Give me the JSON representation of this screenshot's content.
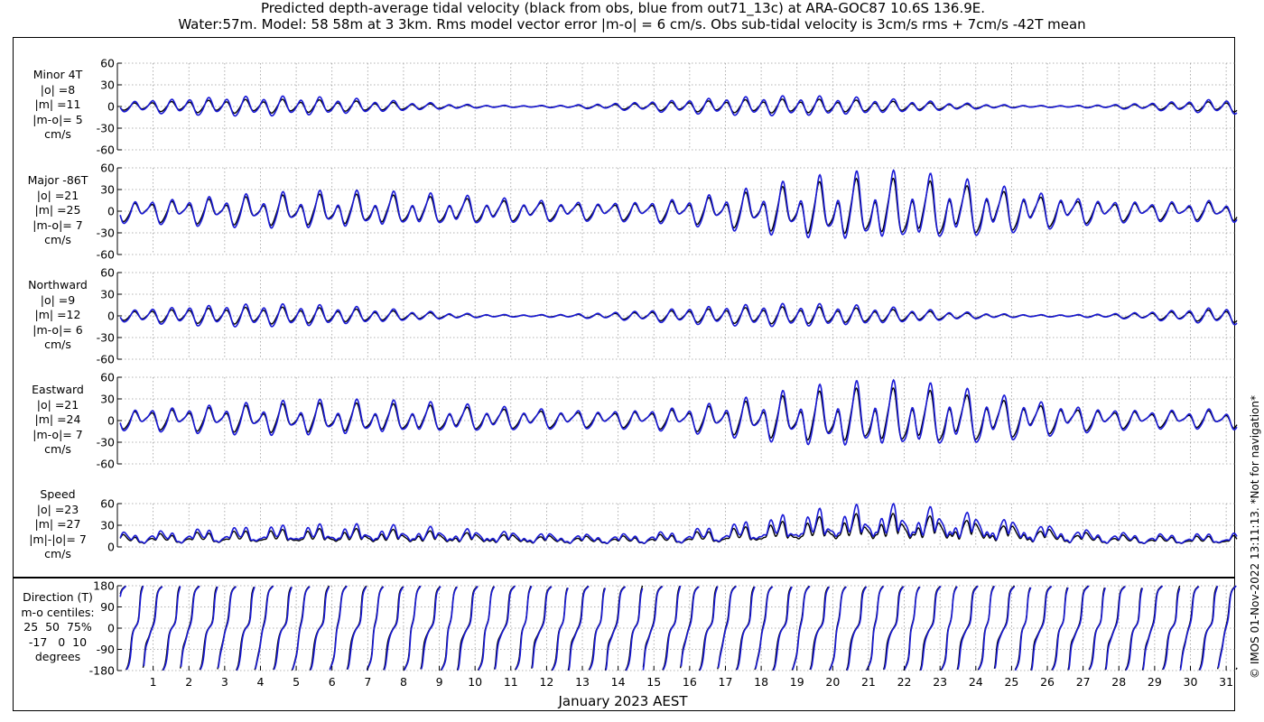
{
  "title_line1": "Predicted depth-average tidal velocity (black from obs, blue from out71_13c) at ARA-GOC87 10.6S 136.9E.",
  "title_line2": "Water:57m. Model: 58 58m at 3 3km. Rms model vector error |m-o| = 6 cm/s. Obs sub-tidal velocity is 3cm/s rms + 7cm/s -42T mean",
  "xlabel": "January 2023 AEST",
  "copyright": "© IMOS 01-Nov-2022 13:11:13. *Not for navigation*",
  "colors": {
    "obs": "#000000",
    "model": "#1a1ad6",
    "grid": "#9a9a9a"
  },
  "panels": [
    {
      "lines": [
        "Minor 4T",
        "|o| =8",
        "|m| =11",
        "|m-o|= 5",
        "cm/s"
      ]
    },
    {
      "lines": [
        "Major -86T",
        "|o| =21",
        "|m| =25",
        "|m-o|= 7",
        "cm/s"
      ]
    },
    {
      "lines": [
        "Northward",
        "|o| =9",
        "|m| =12",
        "|m-o|= 6",
        "cm/s"
      ]
    },
    {
      "lines": [
        "Eastward",
        "|o| =21",
        "|m| =24",
        "|m-o|= 7",
        "cm/s"
      ]
    },
    {
      "lines": [
        "Speed",
        "|o| =23",
        "|m| =27",
        "|m|-|o|= 7",
        "cm/s"
      ]
    },
    {
      "lines": [
        "Direction (T)",
        "m-o centiles:",
        "25  50  75%",
        "-17   0  10",
        "degrees"
      ]
    }
  ],
  "chart_data": [
    {
      "type": "line",
      "panel": "Minor 4T",
      "ylim": [
        -60,
        60
      ],
      "yticks": [
        -60,
        -30,
        0,
        30,
        60
      ],
      "ytick_labels": [
        "-60",
        "-30",
        "0",
        "30",
        "60"
      ],
      "x_range_days": [
        0,
        31.3
      ],
      "grid": true,
      "series": [
        {
          "name": "obs",
          "color": "#000000",
          "amplitude": 9
        },
        {
          "name": "out71_13c",
          "color": "#1a1ad6",
          "amplitude": 13
        }
      ]
    },
    {
      "type": "line",
      "panel": "Major -86T",
      "ylim": [
        -60,
        60
      ],
      "yticks": [
        -60,
        -30,
        0,
        30,
        60
      ],
      "ytick_labels": [
        "-60",
        "-30",
        "0",
        "30",
        "60"
      ],
      "x_range_days": [
        0,
        31.3
      ],
      "grid": true,
      "series": [
        {
          "name": "obs",
          "color": "#000000",
          "amplitude": 38
        },
        {
          "name": "out71_13c",
          "color": "#1a1ad6",
          "amplitude": 46
        }
      ]
    },
    {
      "type": "line",
      "panel": "Northward",
      "ylim": [
        -60,
        60
      ],
      "yticks": [
        -60,
        -30,
        0,
        30,
        60
      ],
      "ytick_labels": [
        "-60",
        "-30",
        "0",
        "30",
        "60"
      ],
      "x_range_days": [
        0,
        31.3
      ],
      "grid": true,
      "series": [
        {
          "name": "obs",
          "color": "#000000",
          "amplitude": 11
        },
        {
          "name": "out71_13c",
          "color": "#1a1ad6",
          "amplitude": 15
        }
      ]
    },
    {
      "type": "line",
      "panel": "Eastward",
      "ylim": [
        -60,
        60
      ],
      "yticks": [
        -60,
        -30,
        0,
        30,
        60
      ],
      "ytick_labels": [
        "-60",
        "-30",
        "0",
        "30",
        "60"
      ],
      "x_range_days": [
        0,
        31.3
      ],
      "grid": true,
      "series": [
        {
          "name": "obs",
          "color": "#000000",
          "amplitude": 36
        },
        {
          "name": "out71_13c",
          "color": "#1a1ad6",
          "amplitude": 44
        }
      ]
    },
    {
      "type": "line",
      "panel": "Speed",
      "ylim": [
        0,
        60
      ],
      "yticks": [
        0,
        30,
        60
      ],
      "ytick_labels": [
        "0",
        "30",
        "60"
      ],
      "x_range_days": [
        0,
        31.3
      ],
      "grid": true,
      "series": [
        {
          "name": "obs",
          "color": "#000000",
          "amplitude": 36
        },
        {
          "name": "out71_13c",
          "color": "#1a1ad6",
          "amplitude": 46
        }
      ]
    },
    {
      "type": "line",
      "panel": "Direction (T)",
      "ylim": [
        -180,
        180
      ],
      "yticks": [
        -180,
        -90,
        0,
        90,
        180
      ],
      "ytick_labels": [
        "-180",
        "-90",
        "0",
        "90",
        "180"
      ],
      "x_range_days": [
        0,
        31.3
      ],
      "grid": true,
      "xticks": [
        1,
        2,
        3,
        4,
        5,
        6,
        7,
        8,
        9,
        10,
        11,
        12,
        13,
        14,
        15,
        16,
        17,
        18,
        19,
        20,
        21,
        22,
        23,
        24,
        25,
        26,
        27,
        28,
        29,
        30,
        31
      ],
      "xtick_labels": [
        "1",
        "2",
        "3",
        "4",
        "5",
        "6",
        "7",
        "8",
        "9",
        "10",
        "11",
        "12",
        "13",
        "14",
        "15",
        "16",
        "17",
        "18",
        "19",
        "20",
        "21",
        "22",
        "23",
        "24",
        "25",
        "26",
        "27",
        "28",
        "29",
        "30",
        "31"
      ],
      "series": [
        {
          "name": "obs",
          "color": "#000000"
        },
        {
          "name": "out71_13c",
          "color": "#1a1ad6"
        }
      ]
    }
  ]
}
